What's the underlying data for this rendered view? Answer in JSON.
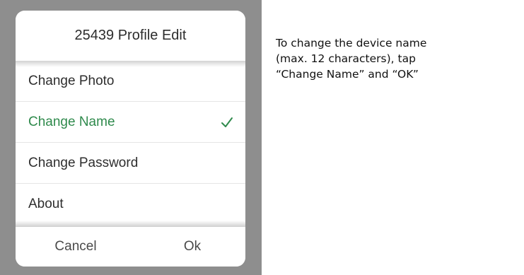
{
  "dialog": {
    "title": "25439 Profile Edit",
    "items": [
      {
        "label": "Change Photo",
        "selected": false
      },
      {
        "label": "Change Name",
        "selected": true
      },
      {
        "label": "Change Password",
        "selected": false
      },
      {
        "label": "About",
        "selected": false
      }
    ],
    "check_icon": "checkmark-icon",
    "cancel_label": "Cancel",
    "ok_label": "Ok"
  },
  "instruction": {
    "lines": [
      "To change the device name",
      "(max. 12 characters), tap",
      "“Change Name” and “OK”"
    ]
  },
  "colors": {
    "accent_green": "#2f8a4c",
    "screen_background": "#8e8e8e",
    "dialog_background": "#ffffff"
  }
}
